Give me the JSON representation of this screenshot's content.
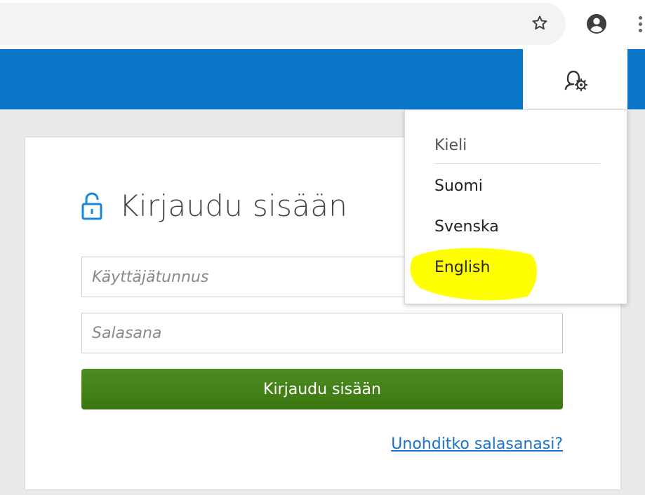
{
  "browser": {
    "star_icon": "star-outline-icon",
    "account_icon": "account-circle-icon",
    "more_icon": "more-vertical-icon"
  },
  "header": {
    "background_color": "#0b77c8",
    "user_settings_icon": "user-gear-icon"
  },
  "login": {
    "title": "Kirjaudu sisään",
    "lock_icon": "unlock-icon",
    "username_placeholder": "Käyttäjätunnus",
    "password_placeholder": "Salasana",
    "submit_label": "Kirjaudu sisään",
    "forgot_link": "Unohditko salasanasi?",
    "button_color": "#46851a"
  },
  "language_menu": {
    "heading": "Kieli",
    "options": [
      "Suomi",
      "Svenska",
      "English"
    ],
    "highlighted_option": "English",
    "highlight_color": "#ffff00"
  }
}
